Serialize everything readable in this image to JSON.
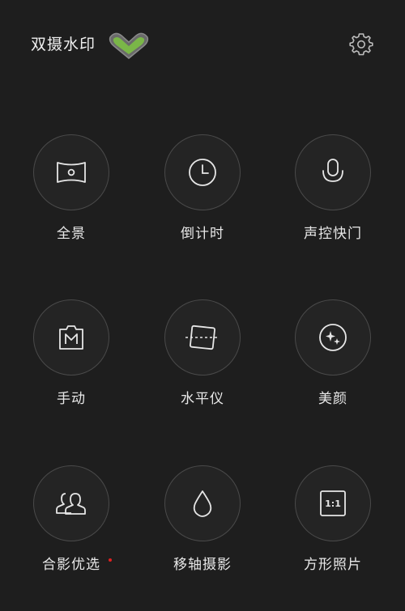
{
  "header": {
    "title": "双摄水印",
    "toggle_state": "on",
    "accent_color": "#7ab648",
    "settings_icon": "gear-icon"
  },
  "modes": [
    {
      "label": "全景",
      "icon": "panorama-icon",
      "badge": false
    },
    {
      "label": "倒计时",
      "icon": "clock-icon",
      "badge": false
    },
    {
      "label": "声控快门",
      "icon": "microphone-icon",
      "badge": false
    },
    {
      "label": "手动",
      "icon": "manual-m-icon",
      "badge": false
    },
    {
      "label": "水平仪",
      "icon": "level-icon",
      "badge": false
    },
    {
      "label": "美颜",
      "icon": "sparkle-icon",
      "badge": false
    },
    {
      "label": "合影优选",
      "icon": "group-icon",
      "badge": true
    },
    {
      "label": "移轴摄影",
      "icon": "drop-icon",
      "badge": false
    },
    {
      "label": "方形照片",
      "icon": "square-ratio-icon",
      "badge": false,
      "icon_text": "1:1"
    }
  ],
  "colors": {
    "background": "#1e1e1e",
    "badge": "#e02020"
  }
}
